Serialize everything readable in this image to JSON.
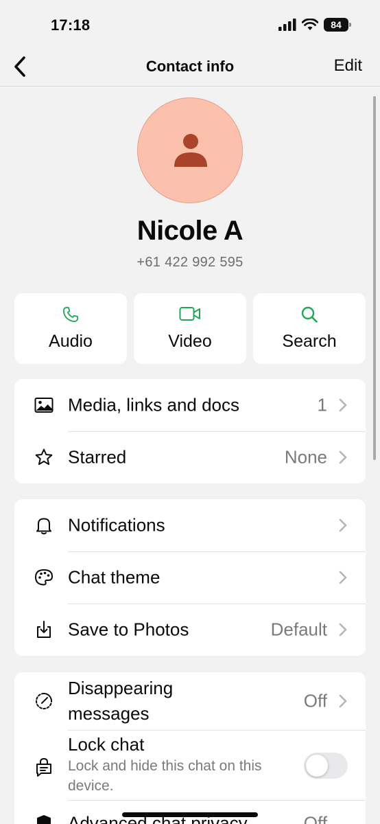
{
  "status": {
    "time": "17:18",
    "battery": "84"
  },
  "nav": {
    "title": "Contact info",
    "edit_label": "Edit"
  },
  "contact": {
    "name": "Nicole A",
    "phone": "+61 422 992 595"
  },
  "actions": [
    {
      "label": "Audio",
      "icon": "phone-icon"
    },
    {
      "label": "Video",
      "icon": "video-icon"
    },
    {
      "label": "Search",
      "icon": "search-icon"
    }
  ],
  "media_section": [
    {
      "label": "Media, links and docs",
      "value": "1",
      "icon": "image-icon"
    },
    {
      "label": "Starred",
      "value": "None",
      "icon": "star-icon"
    }
  ],
  "settings_section": [
    {
      "label": "Notifications",
      "value": "",
      "icon": "bell-icon"
    },
    {
      "label": "Chat theme",
      "value": "",
      "icon": "palette-icon"
    },
    {
      "label": "Save to Photos",
      "value": "Default",
      "icon": "save-download-icon"
    }
  ],
  "privacy_section": {
    "disappearing": {
      "label": "Disappearing messages",
      "value": "Off",
      "icon": "timer-icon"
    },
    "lock_chat": {
      "label": "Lock chat",
      "sublabel": "Lock and hide this chat on this device.",
      "enabled": false,
      "icon": "lock-chat-icon"
    },
    "advanced": {
      "label": "Advanced chat privacy",
      "value": "Off",
      "icon": "shield-icon"
    }
  },
  "colors": {
    "accent": "#1fa855",
    "avatar_bg": "#fcc1ad",
    "avatar_figure": "#a9432a",
    "background": "#f2f2f3"
  }
}
